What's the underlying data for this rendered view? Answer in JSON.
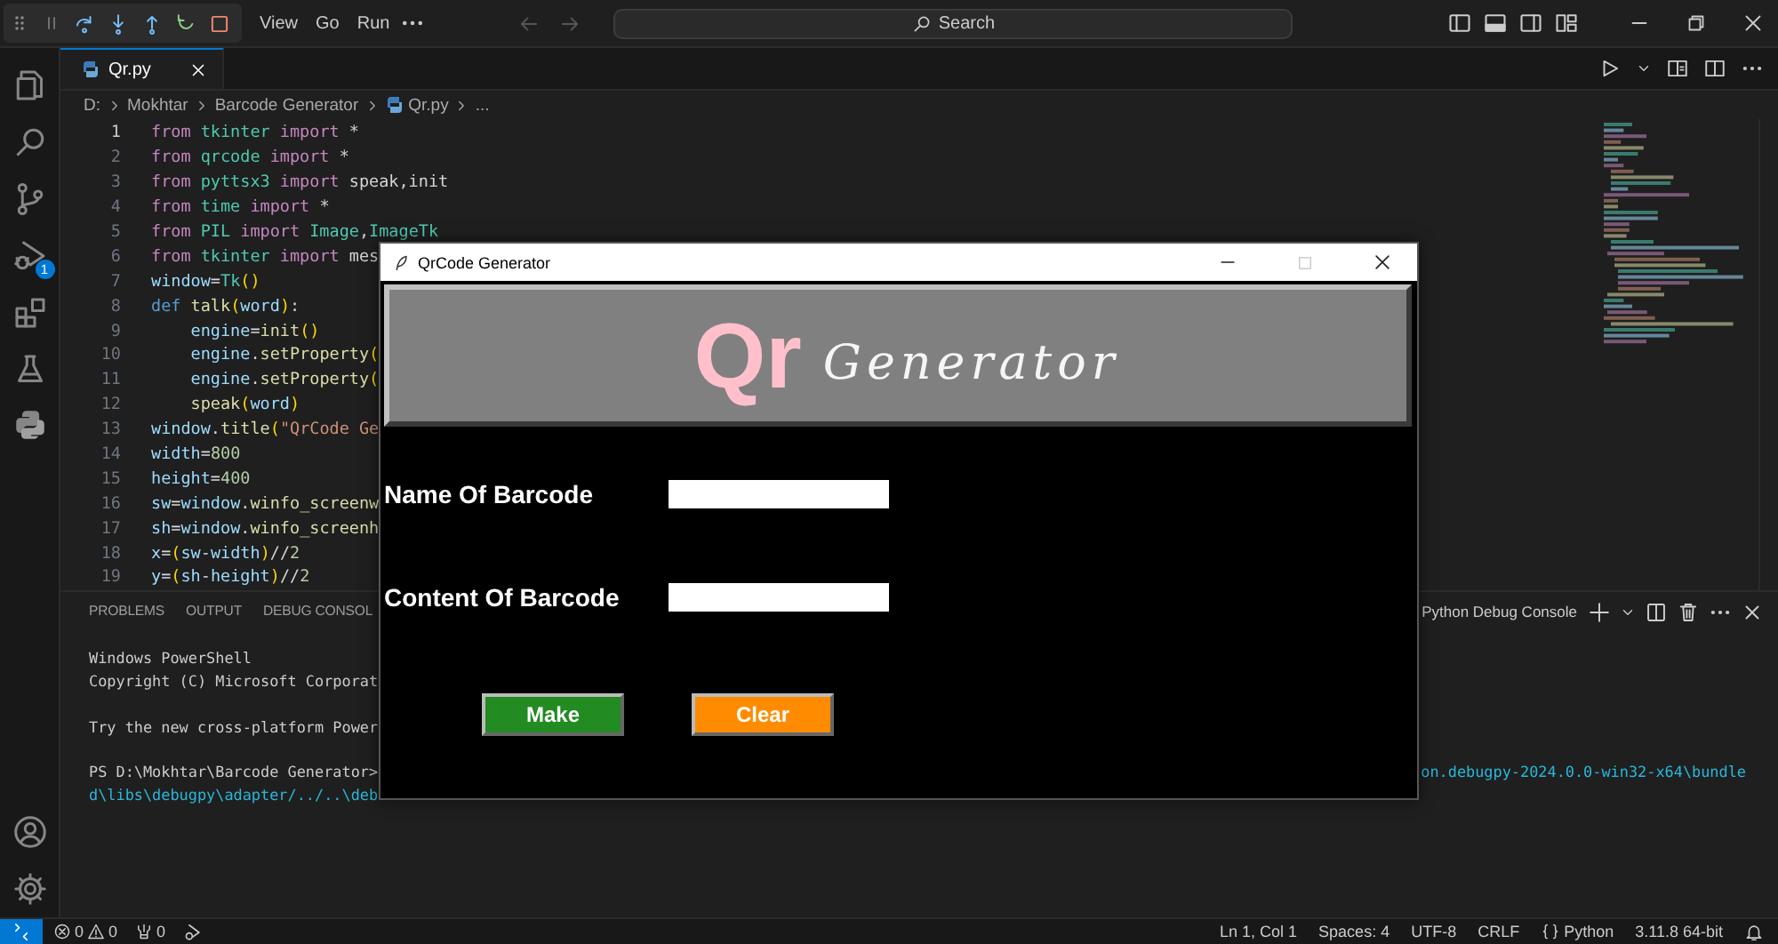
{
  "title_bar": {
    "menu": [
      {
        "label": "View"
      },
      {
        "label": "Go"
      },
      {
        "label": "Run"
      }
    ],
    "command_center": {
      "label": "Search"
    }
  },
  "activity_bar": {
    "debug_badge": "1"
  },
  "editor": {
    "tabs": [
      {
        "label": "Qr.py",
        "selected": true
      }
    ],
    "breadcrumbs": [
      {
        "label": "D:",
        "kind": "folder"
      },
      {
        "label": "Mokhtar",
        "kind": "folder"
      },
      {
        "label": "Barcode Generator",
        "kind": "folder"
      },
      {
        "label": "Qr.py",
        "kind": "file"
      },
      {
        "label": "...",
        "kind": "folder"
      }
    ],
    "lines": [
      {
        "number": "1",
        "current": true,
        "tokens": [
          {
            "text": "from",
            "kind": "control"
          },
          {
            "text": " tkinter",
            "kind": "module"
          },
          {
            "text": " import",
            "kind": "control"
          },
          {
            "text": " *",
            "kind": "plain"
          }
        ]
      },
      {
        "number": "2",
        "current": false,
        "tokens": [
          {
            "text": "from",
            "kind": "control"
          },
          {
            "text": " qrcode",
            "kind": "module"
          },
          {
            "text": " import",
            "kind": "control"
          },
          {
            "text": " *",
            "kind": "plain"
          }
        ]
      },
      {
        "number": "3",
        "current": false,
        "tokens": [
          {
            "text": "from",
            "kind": "control"
          },
          {
            "text": " pyttsx3",
            "kind": "module"
          },
          {
            "text": " import",
            "kind": "control"
          },
          {
            "text": " speak,init",
            "kind": "plain"
          }
        ]
      },
      {
        "number": "4",
        "current": false,
        "tokens": [
          {
            "text": "from",
            "kind": "control"
          },
          {
            "text": " time",
            "kind": "module"
          },
          {
            "text": " import",
            "kind": "control"
          },
          {
            "text": " *",
            "kind": "plain"
          }
        ]
      },
      {
        "number": "5",
        "current": false,
        "tokens": [
          {
            "text": "from",
            "kind": "control"
          },
          {
            "text": " PIL",
            "kind": "module"
          },
          {
            "text": " import",
            "kind": "control"
          },
          {
            "text": " Image",
            "kind": "module"
          },
          {
            "text": ",",
            "kind": "plain"
          },
          {
            "text": "ImageTk",
            "kind": "module"
          }
        ]
      },
      {
        "number": "6",
        "current": false,
        "tokens": [
          {
            "text": "from",
            "kind": "control"
          },
          {
            "text": " tkinter",
            "kind": "module"
          },
          {
            "text": " import",
            "kind": "control"
          },
          {
            "text": " mes",
            "kind": "plain"
          }
        ]
      },
      {
        "number": "7",
        "current": false,
        "tokens": [
          {
            "text": "window",
            "kind": "variable"
          },
          {
            "text": "=",
            "kind": "plain"
          },
          {
            "text": "Tk",
            "kind": "module"
          },
          {
            "text": "()",
            "kind": "bracket"
          }
        ]
      },
      {
        "number": "8",
        "current": false,
        "tokens": [
          {
            "text": "def",
            "kind": "keyword"
          },
          {
            "text": " talk",
            "kind": "function"
          },
          {
            "text": "(",
            "kind": "bracket"
          },
          {
            "text": "word",
            "kind": "variable"
          },
          {
            "text": ")",
            "kind": "bracket"
          },
          {
            "text": ":",
            "kind": "plain"
          }
        ]
      },
      {
        "number": "9",
        "current": false,
        "tokens": [
          {
            "text": "    engine",
            "kind": "variable"
          },
          {
            "text": "=",
            "kind": "plain"
          },
          {
            "text": "init",
            "kind": "function"
          },
          {
            "text": "()",
            "kind": "bracket"
          }
        ]
      },
      {
        "number": "10",
        "current": false,
        "tokens": [
          {
            "text": "    engine",
            "kind": "variable"
          },
          {
            "text": ".",
            "kind": "plain"
          },
          {
            "text": "setProperty",
            "kind": "function"
          },
          {
            "text": "(",
            "kind": "bracket"
          }
        ]
      },
      {
        "number": "11",
        "current": false,
        "tokens": [
          {
            "text": "    engine",
            "kind": "variable"
          },
          {
            "text": ".",
            "kind": "plain"
          },
          {
            "text": "setProperty",
            "kind": "function"
          },
          {
            "text": "(",
            "kind": "bracket"
          }
        ]
      },
      {
        "number": "12",
        "current": false,
        "tokens": [
          {
            "text": "    speak",
            "kind": "function"
          },
          {
            "text": "(",
            "kind": "bracket"
          },
          {
            "text": "word",
            "kind": "variable"
          },
          {
            "text": ")",
            "kind": "bracket"
          }
        ]
      },
      {
        "number": "13",
        "current": false,
        "tokens": [
          {
            "text": "window",
            "kind": "variable"
          },
          {
            "text": ".",
            "kind": "plain"
          },
          {
            "text": "title",
            "kind": "function"
          },
          {
            "text": "(",
            "kind": "bracket"
          },
          {
            "text": "\"QrCode Ge",
            "kind": "string"
          }
        ]
      },
      {
        "number": "14",
        "current": false,
        "tokens": [
          {
            "text": "width",
            "kind": "variable"
          },
          {
            "text": "=",
            "kind": "plain"
          },
          {
            "text": "800",
            "kind": "number"
          }
        ]
      },
      {
        "number": "15",
        "current": false,
        "tokens": [
          {
            "text": "height",
            "kind": "variable"
          },
          {
            "text": "=",
            "kind": "plain"
          },
          {
            "text": "400",
            "kind": "number"
          }
        ]
      },
      {
        "number": "16",
        "current": false,
        "tokens": [
          {
            "text": "sw",
            "kind": "variable"
          },
          {
            "text": "=",
            "kind": "plain"
          },
          {
            "text": "window",
            "kind": "variable"
          },
          {
            "text": ".",
            "kind": "plain"
          },
          {
            "text": "winfo_screenw",
            "kind": "function"
          }
        ]
      },
      {
        "number": "17",
        "current": false,
        "tokens": [
          {
            "text": "sh",
            "kind": "variable"
          },
          {
            "text": "=",
            "kind": "plain"
          },
          {
            "text": "window",
            "kind": "variable"
          },
          {
            "text": ".",
            "kind": "plain"
          },
          {
            "text": "winfo_screenh",
            "kind": "function"
          }
        ]
      },
      {
        "number": "18",
        "current": false,
        "tokens": [
          {
            "text": "x",
            "kind": "variable"
          },
          {
            "text": "=",
            "kind": "plain"
          },
          {
            "text": "(",
            "kind": "bracket"
          },
          {
            "text": "sw",
            "kind": "variable"
          },
          {
            "text": "-",
            "kind": "plain"
          },
          {
            "text": "width",
            "kind": "variable"
          },
          {
            "text": ")",
            "kind": "bracket"
          },
          {
            "text": "//",
            "kind": "plain"
          },
          {
            "text": "2",
            "kind": "number"
          }
        ]
      },
      {
        "number": "19",
        "current": false,
        "tokens": [
          {
            "text": "y",
            "kind": "variable"
          },
          {
            "text": "=",
            "kind": "plain"
          },
          {
            "text": "(",
            "kind": "bracket"
          },
          {
            "text": "sh",
            "kind": "variable"
          },
          {
            "text": "-",
            "kind": "plain"
          },
          {
            "text": "height",
            "kind": "variable"
          },
          {
            "text": ")",
            "kind": "bracket"
          },
          {
            "text": "//",
            "kind": "plain"
          },
          {
            "text": "2",
            "kind": "number"
          }
        ]
      }
    ]
  },
  "panel": {
    "tabs": [
      {
        "label": "PROBLEMS",
        "selected": false
      },
      {
        "label": "OUTPUT",
        "selected": false
      },
      {
        "label": "DEBUG CONSOL",
        "selected": false
      }
    ],
    "terminal_name": "Python Debug Console",
    "lines": [
      {
        "kind": "output",
        "text": "Windows PowerShell"
      },
      {
        "kind": "output",
        "text": "Copyright (C) Microsoft Corporat"
      },
      {
        "kind": "blank"
      },
      {
        "kind": "output",
        "text": "Try the new cross-platform Power"
      },
      {
        "kind": "blank"
      },
      {
        "kind": "output",
        "text": "PS D:\\Mokhtar\\Barcode Generator>",
        "tail": "on.debugpy-2024.0.0-win32-x64\\bundle"
      },
      {
        "kind": "path",
        "text": "d\\libs\\debugpy\\adapter/../..\\deb"
      }
    ]
  },
  "status_bar": {
    "errors": "0",
    "warnings": "0",
    "ports": "0",
    "items": [
      {
        "label": "Ln 1, Col 1",
        "kind": "text"
      },
      {
        "label": "Spaces: 4",
        "kind": "text"
      },
      {
        "label": "UTF-8",
        "kind": "text"
      },
      {
        "label": "CRLF",
        "kind": "text"
      },
      {
        "label": "Python",
        "kind": "language"
      },
      {
        "label": "3.11.8 64-bit",
        "kind": "text"
      }
    ]
  },
  "app_window": {
    "title": "QrCode Generator",
    "maximize": {
      "disabled": true
    },
    "banner": {
      "bold": "Qr",
      "script": "Generator"
    },
    "fields": [
      {
        "label": "Name Of Barcode"
      },
      {
        "label": "Content Of Barcode"
      }
    ],
    "buttons": [
      {
        "label": "Make",
        "color": "#228b22"
      },
      {
        "label": "Clear",
        "color": "#ff8c00"
      }
    ]
  }
}
